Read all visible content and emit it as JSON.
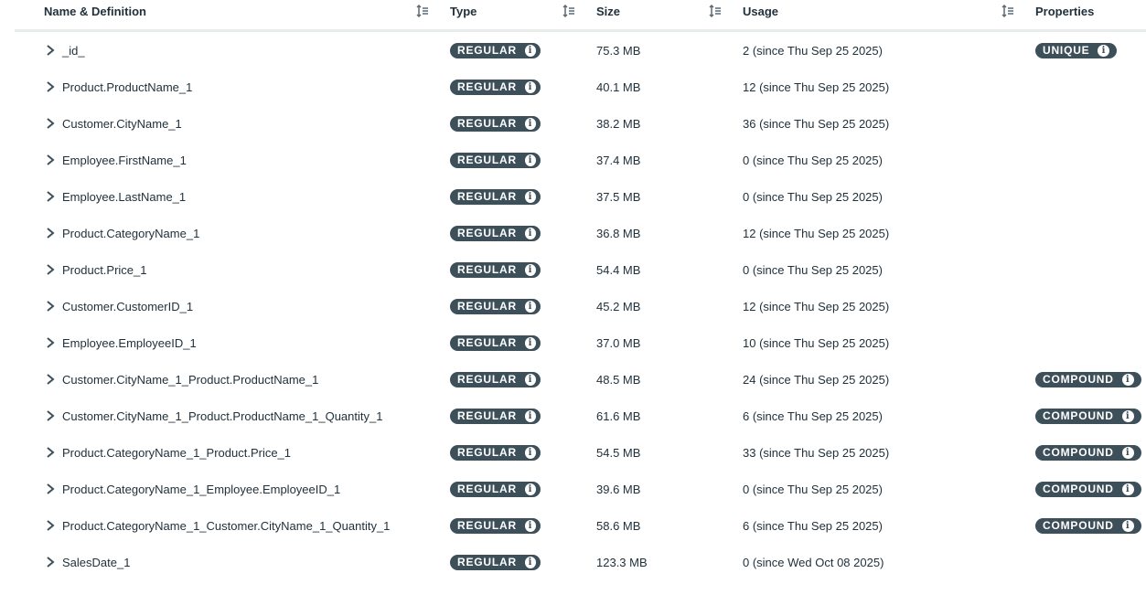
{
  "headers": {
    "name": "Name & Definition",
    "type": "Type",
    "size": "Size",
    "usage": "Usage",
    "properties": "Properties"
  },
  "info_glyph": "i",
  "rows": [
    {
      "name": "_id_",
      "type": "REGULAR",
      "size": "75.3 MB",
      "usage": "2 (since Thu Sep 25 2025)",
      "property": "UNIQUE"
    },
    {
      "name": "Product.ProductName_1",
      "type": "REGULAR",
      "size": "40.1 MB",
      "usage": "12 (since Thu Sep 25 2025)",
      "property": ""
    },
    {
      "name": "Customer.CityName_1",
      "type": "REGULAR",
      "size": "38.2 MB",
      "usage": "36 (since Thu Sep 25 2025)",
      "property": ""
    },
    {
      "name": "Employee.FirstName_1",
      "type": "REGULAR",
      "size": "37.4 MB",
      "usage": "0 (since Thu Sep 25 2025)",
      "property": ""
    },
    {
      "name": "Employee.LastName_1",
      "type": "REGULAR",
      "size": "37.5 MB",
      "usage": "0 (since Thu Sep 25 2025)",
      "property": ""
    },
    {
      "name": "Product.CategoryName_1",
      "type": "REGULAR",
      "size": "36.8 MB",
      "usage": "12 (since Thu Sep 25 2025)",
      "property": ""
    },
    {
      "name": "Product.Price_1",
      "type": "REGULAR",
      "size": "54.4 MB",
      "usage": "0 (since Thu Sep 25 2025)",
      "property": ""
    },
    {
      "name": "Customer.CustomerID_1",
      "type": "REGULAR",
      "size": "45.2 MB",
      "usage": "12 (since Thu Sep 25 2025)",
      "property": ""
    },
    {
      "name": "Employee.EmployeeID_1",
      "type": "REGULAR",
      "size": "37.0 MB",
      "usage": "10 (since Thu Sep 25 2025)",
      "property": ""
    },
    {
      "name": "Customer.CityName_1_Product.ProductName_1",
      "type": "REGULAR",
      "size": "48.5 MB",
      "usage": "24 (since Thu Sep 25 2025)",
      "property": "COMPOUND"
    },
    {
      "name": "Customer.CityName_1_Product.ProductName_1_Quantity_1",
      "type": "REGULAR",
      "size": "61.6 MB",
      "usage": "6 (since Thu Sep 25 2025)",
      "property": "COMPOUND"
    },
    {
      "name": "Product.CategoryName_1_Product.Price_1",
      "type": "REGULAR",
      "size": "54.5 MB",
      "usage": "33 (since Thu Sep 25 2025)",
      "property": "COMPOUND"
    },
    {
      "name": "Product.CategoryName_1_Employee.EmployeeID_1",
      "type": "REGULAR",
      "size": "39.6 MB",
      "usage": "0 (since Thu Sep 25 2025)",
      "property": "COMPOUND"
    },
    {
      "name": "Product.CategoryName_1_Customer.CityName_1_Quantity_1",
      "type": "REGULAR",
      "size": "58.6 MB",
      "usage": "6 (since Thu Sep 25 2025)",
      "property": "COMPOUND"
    },
    {
      "name": "SalesDate_1",
      "type": "REGULAR",
      "size": "123.3 MB",
      "usage": "0 (since Wed Oct 08 2025)",
      "property": ""
    }
  ]
}
